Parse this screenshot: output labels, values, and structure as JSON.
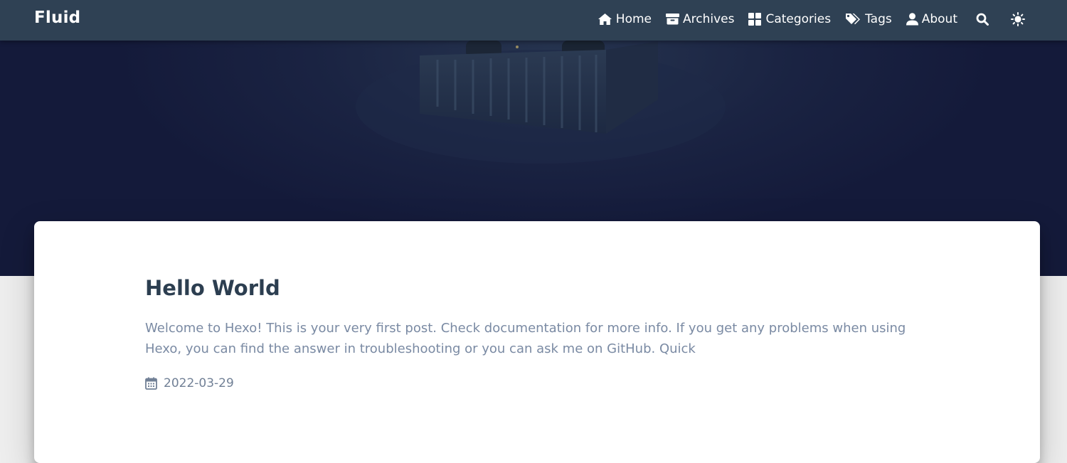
{
  "navbar": {
    "brand": "Fluid",
    "items": [
      {
        "label": "Home",
        "icon": "home-icon"
      },
      {
        "label": "Archives",
        "icon": "archive-icon"
      },
      {
        "label": "Categories",
        "icon": "categories-icon"
      },
      {
        "label": "Tags",
        "icon": "tags-icon"
      },
      {
        "label": "About",
        "icon": "user-icon"
      }
    ],
    "search_icon": "search-icon",
    "theme_icon": "sun-icon"
  },
  "post": {
    "title": "Hello World",
    "excerpt": "Welcome to Hexo! This is your very first post. Check documentation for more info. If you get any problems when using Hexo, you can find the answer in troubleshooting or you can ask me on GitHub. Quick",
    "date": "2022-03-29",
    "date_icon": "calendar-icon"
  },
  "colors": {
    "navbar_bg": "#2f4154",
    "banner_bg": "#1a2342",
    "page_bg": "#eeeeee",
    "card_bg": "#ffffff",
    "title": "#2c3e50",
    "excerpt": "#7a8aa3",
    "meta": "#718096"
  }
}
